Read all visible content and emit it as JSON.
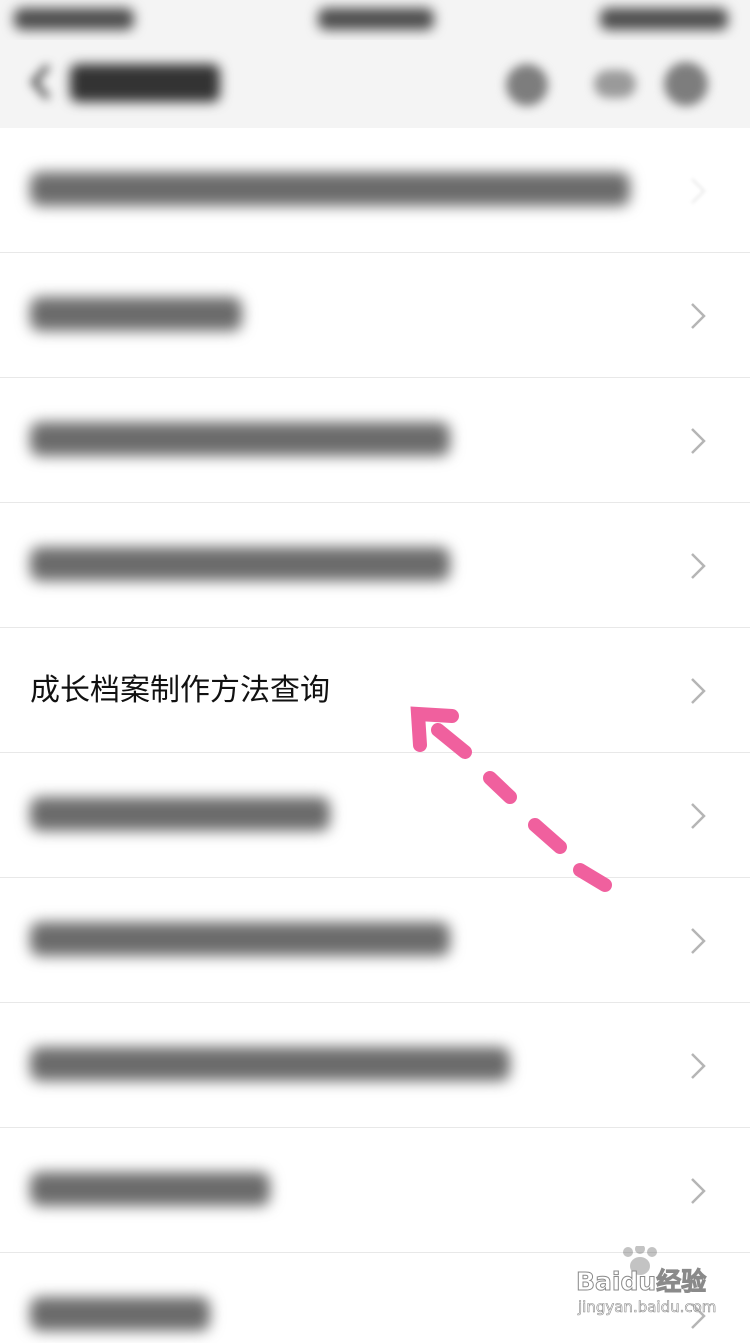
{
  "list": {
    "highlighted_item": {
      "label": "成长档案制作方法查询"
    }
  },
  "annotation": {
    "arrow_color": "#f0609e"
  },
  "watermark": {
    "brand": "Baidu经验",
    "url": "jingyan.baidu.com"
  }
}
